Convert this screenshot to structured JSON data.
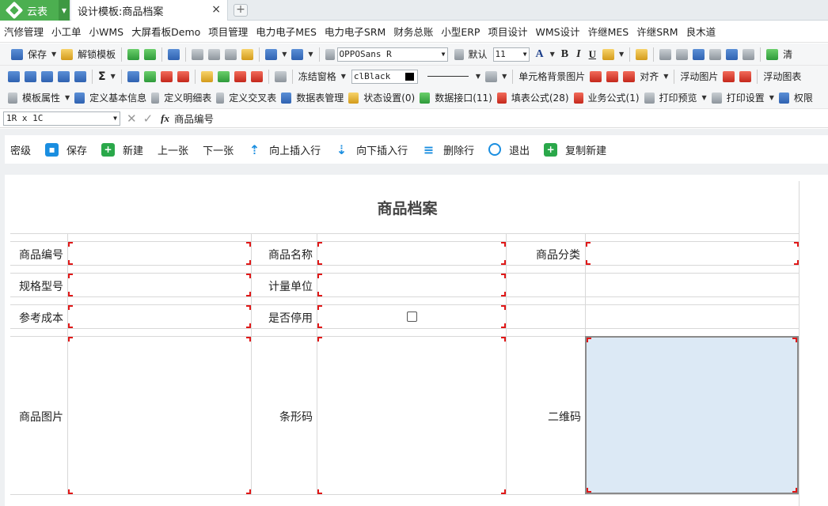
{
  "titlebar": {
    "app_name": "云表",
    "tab_label": "设计模板:商品档案",
    "close_glyph": "×",
    "add_tab_glyph": "+"
  },
  "menu": [
    "汽修管理",
    "小工单",
    "小WMS",
    "大屏看板Demo",
    "项目管理",
    "电力电子MES",
    "电力电子SRM",
    "财务总账",
    "小型ERP",
    "项目设计",
    "WMS设计",
    "许继MES",
    "许继SRM",
    "良木道"
  ],
  "toolbar1": {
    "save": "保存",
    "unlock_template": "解锁模板",
    "font_name": "OPPOSans R",
    "default_label": "默认",
    "font_size": "11",
    "bold": "B",
    "italic": "I",
    "underline": "U",
    "font_color_glyph": "A",
    "refresh_label": "清"
  },
  "toolbar2": {
    "sum_glyph": "Σ",
    "freeze": "冻结窗格",
    "color_value": "clBlack",
    "cell_bg_image": "单元格背景图片",
    "align": "对齐",
    "float_image": "浮动图片",
    "float_chart": "浮动图表"
  },
  "toolbar3": {
    "template_props": "模板属性",
    "define_basic": "定义基本信息",
    "define_detail": "定义明细表",
    "define_cross": "定义交叉表",
    "data_table_mgmt": "数据表管理",
    "status_settings": "状态设置(0)",
    "data_interface": "数据接口(11)",
    "fill_formula": "填表公式(28)",
    "business_formula": "业务公式(1)",
    "print_preview": "打印预览",
    "print_settings": "打印设置",
    "permissions": "权限"
  },
  "formula_bar": {
    "cell_ref": "1R x 1C",
    "fx": "fx",
    "value": "商品编号"
  },
  "actions": {
    "password": "密级",
    "save": "保存",
    "new": "新建",
    "prev": "上一张",
    "next": "下一张",
    "insert_up": "向上插入行",
    "insert_down": "向下插入行",
    "delete_row": "删除行",
    "exit": "退出",
    "copy_new": "复制新建"
  },
  "form": {
    "title": "商品档案",
    "product_code": "商品编号",
    "product_name": "商品名称",
    "product_category": "商品分类",
    "spec_model": "规格型号",
    "unit": "计量单位",
    "ref_cost": "参考成本",
    "disabled": "是否停用",
    "product_image": "商品图片",
    "barcode": "条形码",
    "qrcode": "二维码",
    "disabled_checked": false
  }
}
